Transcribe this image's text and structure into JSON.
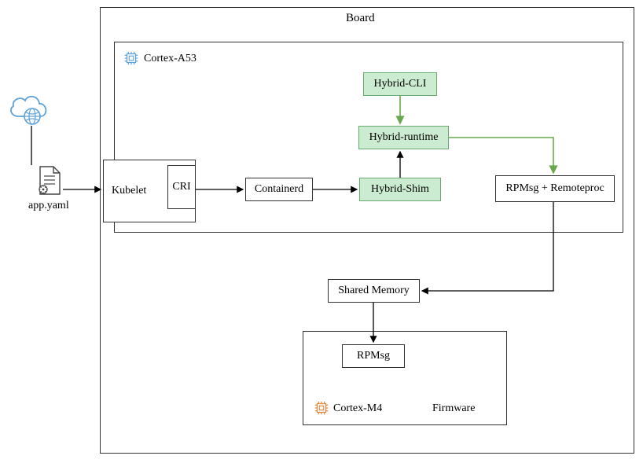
{
  "board": {
    "title": "Board"
  },
  "cortexA53": {
    "label": "Cortex-A53"
  },
  "cortexM4": {
    "label": "Cortex-M4"
  },
  "firmware": {
    "label": "Firmware"
  },
  "kubelet": {
    "label": "Kubelet"
  },
  "cri": {
    "label": "CRI"
  },
  "containerd": {
    "label": "Containerd"
  },
  "hybridShim": {
    "label": "Hybrid-Shim"
  },
  "hybridRuntime": {
    "label": "Hybrid-runtime"
  },
  "hybridCli": {
    "label": "Hybrid-CLI"
  },
  "rpmsgRemoteproc": {
    "label": "RPMsg + Remoteproc"
  },
  "sharedMemory": {
    "label": "Shared Memory"
  },
  "rpmsg": {
    "label": "RPMsg"
  },
  "appYaml": {
    "label": "app.yaml"
  }
}
